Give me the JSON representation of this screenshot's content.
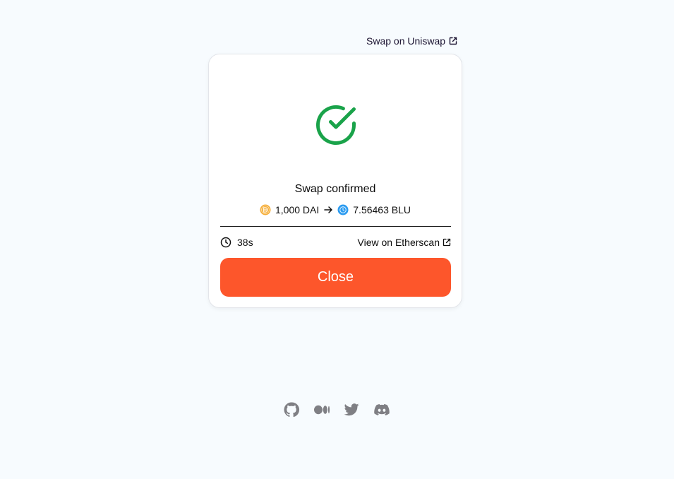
{
  "header": {
    "swap_link_label": "Swap on Uniswap",
    "swap_link_icon": "external-link-icon"
  },
  "modal": {
    "status_icon": "check-circle-icon",
    "status_color": "#1aa34a",
    "title": "Swap confirmed",
    "summary": {
      "from_amount": "1,000 DAI",
      "from_token_icon": "dai-token-icon",
      "arrow_icon": "arrow-right-icon",
      "to_amount": "7.56463 BLU",
      "to_token_icon": "blu-token-icon"
    },
    "elapsed": {
      "icon": "clock-icon",
      "value": "38s"
    },
    "explorer_link_label": "View on Etherscan",
    "close_label": "Close",
    "close_color": "#fd562b"
  },
  "footer": {
    "socials": [
      {
        "name": "GitHub",
        "icon": "github-icon"
      },
      {
        "name": "Medium",
        "icon": "medium-icon"
      },
      {
        "name": "Twitter",
        "icon": "twitter-icon"
      },
      {
        "name": "Discord",
        "icon": "discord-icon"
      }
    ]
  }
}
